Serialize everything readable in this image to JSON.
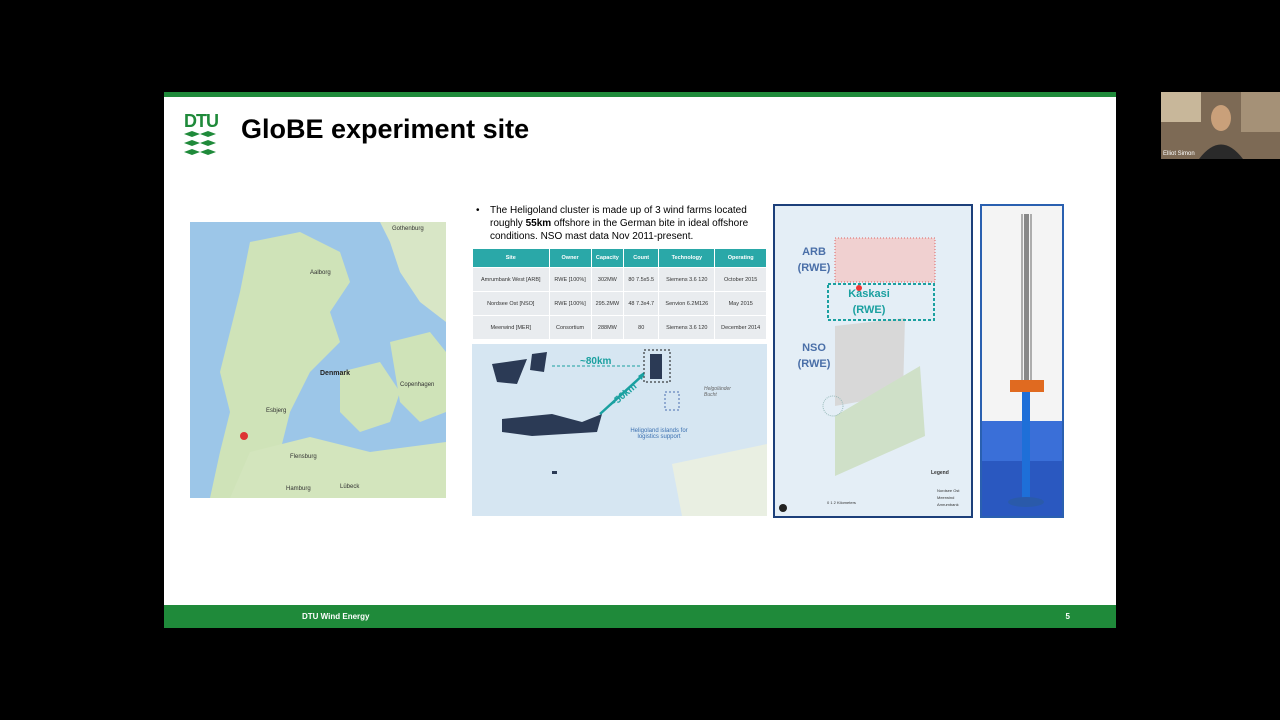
{
  "slide": {
    "logo_text": "DTU",
    "title": "GloBE experiment site",
    "footer_org": "DTU Wind Energy",
    "page_number": "5"
  },
  "map_labels": {
    "gothenburg": "Gothenburg",
    "aalborg": "Aalborg",
    "denmark": "Denmark",
    "copenhagen": "Copenhagen",
    "flensburg": "Flensburg",
    "lubeck": "Lübeck",
    "esbjerg": "Esbjerg",
    "hamburg": "Hamburg"
  },
  "bullet": {
    "part1": "The Heligoland cluster is made up of 3 wind farms located roughly ",
    "bold": "55km",
    "part2": " offshore in the German bite in ideal offshore conditions. NSO mast data Nov 2011-present."
  },
  "table": {
    "headers": [
      "Site",
      "Owner",
      "Capacity",
      "Count",
      "Technology",
      "Operating"
    ],
    "rows": [
      [
        "Amrumbank West [ARB]",
        "RWE [100%]",
        "302MW",
        "80 7.5x5.5",
        "Siemens 3.6 120",
        "October 2015"
      ],
      [
        "Nordsee Ost [NSO]",
        "RWE [100%]",
        "295.2MW",
        "48 7.3x4.7",
        "Senvion 6.2M126",
        "May 2015"
      ],
      [
        "Meerwind [MER]",
        "Consortium",
        "288MW",
        "80",
        "Siemens 3.6 120",
        "December 2014"
      ]
    ]
  },
  "cluster_map": {
    "dist1": "~80km",
    "dist2": "~50km",
    "heligoland_note": "Heligoland islands for logistics support",
    "helgolander": "Helgoländer Bucht"
  },
  "farm_map": {
    "arb": "ARB (RWE)",
    "kaskasi": "Kaskasi (RWE)",
    "nso": "NSO (RWE)",
    "legend_title": "Legend",
    "legend_items": [
      "Nordsee Ost",
      "Meerwind",
      "Amrumbank"
    ],
    "scale": "0    1    2 Kilometers"
  },
  "webcam": {
    "name": "Elliot Simon"
  },
  "colors": {
    "brand_green": "#1f8a3a",
    "teal": "#2aa8a8",
    "navy": "#1c3f7a"
  }
}
